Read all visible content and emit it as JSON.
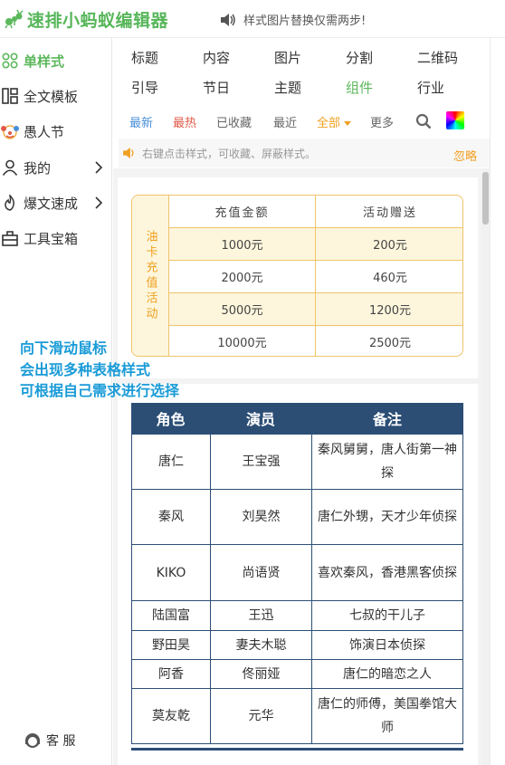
{
  "app": {
    "title": "速排小蚂蚁编辑器",
    "notice": "样式图片替换仅需两步!"
  },
  "sidebar": {
    "items": [
      {
        "label": "单样式",
        "icon": "grid-icon"
      },
      {
        "label": "全文模板",
        "icon": "layout-icon"
      },
      {
        "label": "愚人节",
        "icon": "clown-icon"
      },
      {
        "label": "我的",
        "icon": "user-icon"
      },
      {
        "label": "爆文速成",
        "icon": "fire-icon"
      },
      {
        "label": "工具宝箱",
        "icon": "toolbox-icon"
      }
    ],
    "service": "客 服"
  },
  "categories": {
    "row1": [
      "标题",
      "内容",
      "图片",
      "分割",
      "二维码"
    ],
    "row2": [
      "引导",
      "节日",
      "主题",
      "组件",
      "行业"
    ]
  },
  "filters": {
    "latest": "最新",
    "hot": "最热",
    "saved": "已收藏",
    "recent": "最近",
    "all": "全部",
    "more": "更多"
  },
  "tip": {
    "text": "右键点击样式，可收藏、屏蔽样式。",
    "ignore": "忽略"
  },
  "annotation": [
    "向下滑动鼠标",
    "会出现多种表格样式",
    "可根据自己需求进行选择"
  ],
  "table1": {
    "side_label": "油卡充值活动",
    "headers": [
      "充值金额",
      "活动赠送"
    ],
    "rows": [
      [
        "1000元",
        "200元"
      ],
      [
        "2000元",
        "460元"
      ],
      [
        "5000元",
        "1200元"
      ],
      [
        "10000元",
        "2500元"
      ]
    ]
  },
  "table2": {
    "headers": [
      "角色",
      "演员",
      "备注"
    ],
    "rows": [
      [
        "唐仁",
        "王宝强",
        "秦风舅舅，唐人街第一神探"
      ],
      [
        "秦风",
        "刘昊然",
        "唐仁外甥，天才少年侦探"
      ],
      [
        "KIKO",
        "尚语贤",
        "喜欢秦风，香港黑客侦探"
      ],
      [
        "陆国富",
        "王迅",
        "七叔的干儿子"
      ],
      [
        "野田昊",
        "妻夫木聪",
        "饰演日本侦探"
      ],
      [
        "阿香",
        "佟丽娅",
        "唐仁的暗恋之人"
      ],
      [
        "莫友乾",
        "元华",
        "唐仁的师傅，美国拳馆大师"
      ]
    ]
  },
  "colors": {
    "brand_green": "#5cb85c",
    "table_navy": "#2c4e75",
    "table_gold": "#f0c36a",
    "annotation_blue": "#1a9bd7"
  }
}
